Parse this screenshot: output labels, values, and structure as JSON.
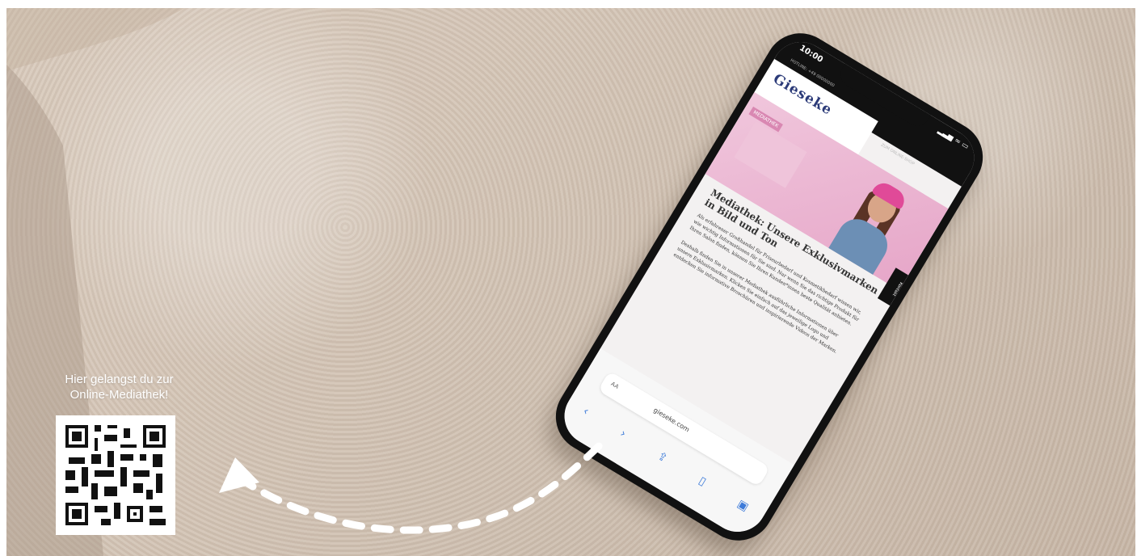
{
  "overlay": {
    "qr_caption_line1": "Hier gelangst du zur",
    "qr_caption_line2": "Online-Mediathek!"
  },
  "phone": {
    "time": "10:00",
    "status_icons": "▂▃▅ ≈ ▭",
    "hotline": "HOTLINE: +49 00000000",
    "logo": "Gieseke",
    "shop_link": "ZUM ONLINE-SHOP",
    "mediathek_tag": "MEDIATHEK",
    "contact_tab": "Kontakt",
    "headline": "Mediathek: Unsere Exklusivmarken in Bild und Ton",
    "paragraph_1": "Als erfahrener Großhandel für Friseurbedarf und Kosmetikbedarf wissen wir, wie wichtig Informationen für Sie sind. Nur wenn Sie das richtige Produkt für Ihren Salon finden, können Sie Ihren Kunden*innen beste Qualität anbieten.",
    "paragraph_2": "Deshalb finden Sie in unserer Mediathek ausführliche Informationen über unsere Exklusivmarken. Klicken Sie einfach auf das jeweilige Logo und entdecken Sie informative Broschüren und inspirierende Videos der Marken.",
    "browser_aa": "AA",
    "url": "gieseke.com"
  }
}
